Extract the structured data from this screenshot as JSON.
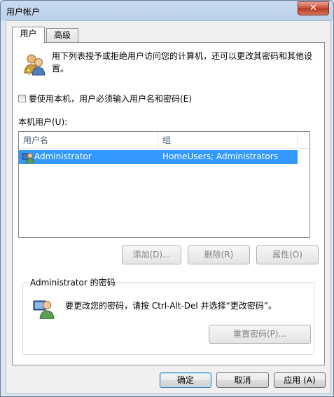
{
  "window": {
    "title": "用户帐户",
    "close_glyph": "✕"
  },
  "tabs": [
    {
      "label": "用户",
      "active": true
    },
    {
      "label": "高级",
      "active": false
    }
  ],
  "users_tab": {
    "description": "用下列表授予或拒绝用户访问您的计算机，还可以更改其密码和其他设置。",
    "require_login_label": "要使用本机，用户必须输入用户名和密码(E)",
    "require_login_checked": false,
    "local_users_label": "本机用户(U):",
    "list": {
      "columns": [
        "用户名",
        "组"
      ],
      "rows": [
        {
          "username": "Administrator",
          "group": "HomeUsers; Administrators",
          "selected": true
        }
      ]
    },
    "buttons": {
      "add": "添加(D)...",
      "remove": "删除(R)",
      "properties": "属性(O)"
    },
    "password_group": {
      "title": "Administrator 的密码",
      "message": "要更改您的密码，请按 Ctrl-Alt-Del 并选择“更改密码”。",
      "reset_button": "重置密码(P)..."
    }
  },
  "footer": {
    "ok": "确定",
    "cancel": "取消",
    "apply": "应用 (A)"
  },
  "colors": {
    "selection": "#3399ff",
    "close_button": "#c74b32",
    "disabled_text": "#838383"
  }
}
